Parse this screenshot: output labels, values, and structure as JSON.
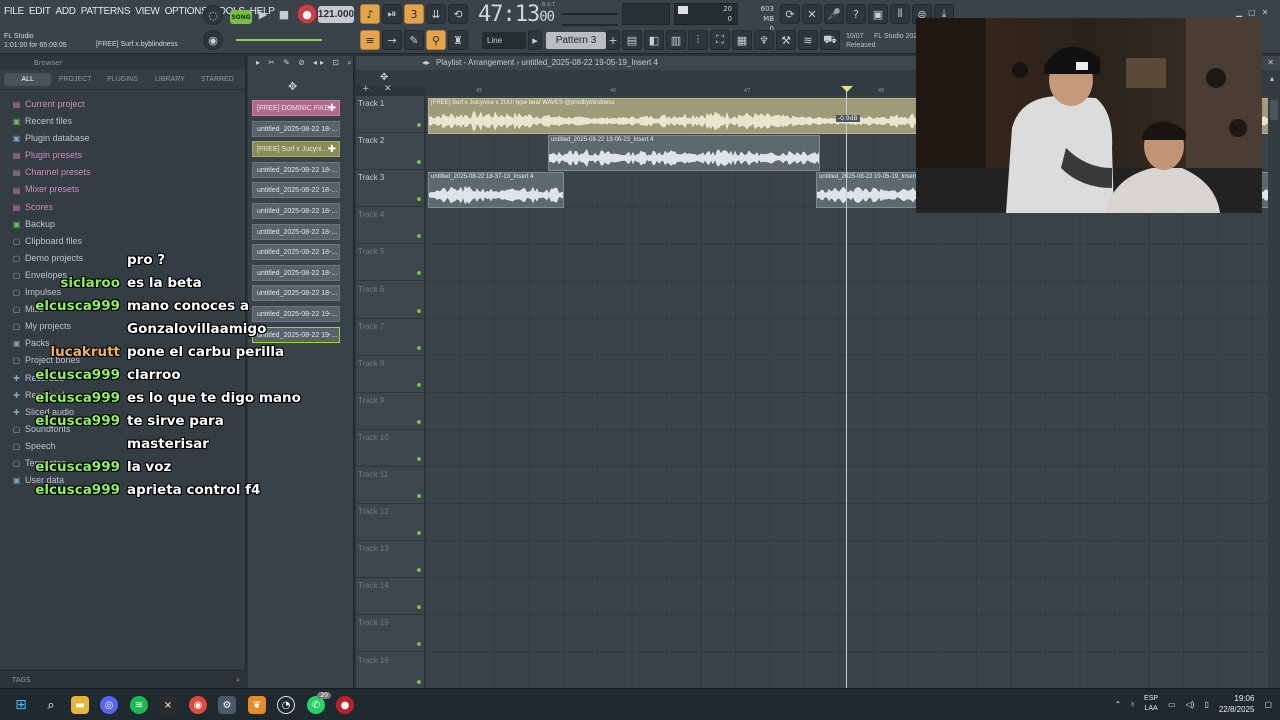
{
  "menu": [
    "FILE",
    "EDIT",
    "ADD",
    "PATTERNS",
    "VIEW",
    "OPTIONS",
    "TOOLS",
    "HELP"
  ],
  "project": {
    "app_name": "FL Studio",
    "position_info": "1:01:00 for 65:09:05",
    "hint_text": "[FREE] Surf x.byblindness"
  },
  "transport": {
    "mode": "SONG",
    "tempo": "121.000",
    "time_main": "47:13",
    "time_sub": "00",
    "time_label": "B:S:T",
    "cpu_value": "20",
    "cpu_value2": "0",
    "ram_mb": "603 MB",
    "ram_value": "0"
  },
  "toolbar2": {
    "snap_mode": "Line",
    "pattern": "Pattern 3"
  },
  "news": {
    "date": "10/07",
    "title": "FL Studio 2025",
    "status": "Released"
  },
  "browser": {
    "title": "Browser",
    "tabs": [
      "ALL",
      "PROJECT",
      "PLUGINS",
      "LIBRARY",
      "STARRED"
    ],
    "active_tab": "ALL",
    "items": [
      {
        "label": "Current project",
        "style": "pink",
        "icon": "doc-icon"
      },
      {
        "label": "Recent files",
        "style": "green",
        "icon": "clock-icon"
      },
      {
        "label": "Plugin database",
        "style": "",
        "icon": "plug-icon"
      },
      {
        "label": "Plugin presets",
        "style": "pink",
        "icon": "plug-preset-icon"
      },
      {
        "label": "Channel presets",
        "style": "pink",
        "icon": "channel-preset-icon"
      },
      {
        "label": "Mixer presets",
        "style": "pink",
        "icon": "mixer-preset-icon"
      },
      {
        "label": "Scores",
        "style": "pink",
        "icon": "score-icon"
      },
      {
        "label": "Backup",
        "style": "green",
        "icon": "backup-icon"
      },
      {
        "label": "Clipboard files",
        "style": "",
        "icon": "folder-icon"
      },
      {
        "label": "Demo projects",
        "style": "",
        "icon": "folder-icon"
      },
      {
        "label": "Envelopes",
        "style": "",
        "icon": "folder-icon"
      },
      {
        "label": "Impulses",
        "style": "",
        "icon": "folder-icon"
      },
      {
        "label": "Misc",
        "style": "",
        "icon": "folder-icon"
      },
      {
        "label": "My projects",
        "style": "",
        "icon": "folder-icon"
      },
      {
        "label": "Packs",
        "style": "",
        "icon": "pack-icon"
      },
      {
        "label": "Project bones",
        "style": "",
        "icon": "folder-icon"
      },
      {
        "label": "Recorded",
        "style": "",
        "icon": "plus-icon"
      },
      {
        "label": "Rendered",
        "style": "",
        "icon": "plus-icon"
      },
      {
        "label": "Sliced audio",
        "style": "",
        "icon": "plus-icon"
      },
      {
        "label": "Soundfonts",
        "style": "",
        "icon": "folder-icon"
      },
      {
        "label": "Speech",
        "style": "",
        "icon": "folder-icon"
      },
      {
        "label": "Templates",
        "style": "",
        "icon": "folder-icon"
      },
      {
        "label": "User data",
        "style": "",
        "icon": "user-icon"
      }
    ],
    "tags_label": "TAGS"
  },
  "chat": [
    {
      "user": "",
      "user_color": "#ffffff",
      "msg": "pro ?"
    },
    {
      "user": "siclaroo",
      "user_color": "#8ef25a",
      "msg": "es la beta"
    },
    {
      "user": "elcusca999",
      "user_color": "#8ef25a",
      "msg": "mano conoces a"
    },
    {
      "user": "",
      "user_color": "#ffffff",
      "msg": "Gonzalovillaamigo"
    },
    {
      "user": "lucakrutt",
      "user_color": "#f0b35a",
      "msg": "pone el carbu perilla"
    },
    {
      "user": "elcusca999",
      "user_color": "#8ef25a",
      "msg": "clarroo"
    },
    {
      "user": "elcusca999",
      "user_color": "#8ef25a",
      "msg": "es lo que te digo mano"
    },
    {
      "user": "elcusca999",
      "user_color": "#8ef25a",
      "msg": "te sirve para"
    },
    {
      "user": "",
      "user_color": "#ffffff",
      "msg": "masterisar"
    },
    {
      "user": "elcusca999",
      "user_color": "#8ef25a",
      "msg": "la voz"
    },
    {
      "user": "elcusca999",
      "user_color": "#8ef25a",
      "msg": "aprieta control f4"
    }
  ],
  "picker": [
    {
      "label": "[FREE] DOMINIC FIKE...",
      "style": "pink"
    },
    {
      "label": "untitled_2025-08-22 18-...",
      "style": ""
    },
    {
      "label": "[FREE] Surf x Jucyni...",
      "style": "olive"
    },
    {
      "label": "untitled_2025-08-22 18-...",
      "style": ""
    },
    {
      "label": "untitled_2025-08-22 18-...",
      "style": ""
    },
    {
      "label": "untitled_2025-08-22 18-...",
      "style": ""
    },
    {
      "label": "untitled_2025-08-22 18-...",
      "style": ""
    },
    {
      "label": "untitled_2025-08-22 18-...",
      "style": ""
    },
    {
      "label": "untitled_2025-08-22 18-...",
      "style": ""
    },
    {
      "label": "untitled_2025-08-22 18-...",
      "style": ""
    },
    {
      "label": "untitled_2025-08-22 19-...",
      "style": ""
    },
    {
      "label": "untitled_2025-08-22 19-...",
      "style": "sel"
    }
  ],
  "playlist": {
    "title": "Playlist - Arrangement",
    "pattern_name": "untitled_2025-08-22 19-05-19_Insert 4",
    "ruler": [
      "45",
      "46",
      "47",
      "48"
    ],
    "tracks": [
      "Track 1",
      "Track 2",
      "Track 3",
      "Track 4",
      "Track 5",
      "Track 6",
      "Track 7",
      "Track 8",
      "Track 9",
      "Track 10",
      "Track 11",
      "Track 12",
      "Track 13",
      "Track 14",
      "Track 15",
      "Track 16"
    ],
    "clips": {
      "t1": "[FREE] Surf x Juicynise x 2UU! type beat  WAVES  @prodbyblindness",
      "t2": "untitled_2025-08-22 19-00-23_Insert 4",
      "t3a": "untitled_2025-08-22 18-37-13_Insert 4",
      "t3b": "untitled_2025-08-22 19-05-19_Insert 4"
    },
    "volume_tip": "-0.9dB"
  },
  "taskbar": {
    "lang_top": "ESP",
    "lang_bottom": "LAA",
    "time": "19:06",
    "date": "22/8/2025",
    "whatsapp_badge": "20"
  }
}
